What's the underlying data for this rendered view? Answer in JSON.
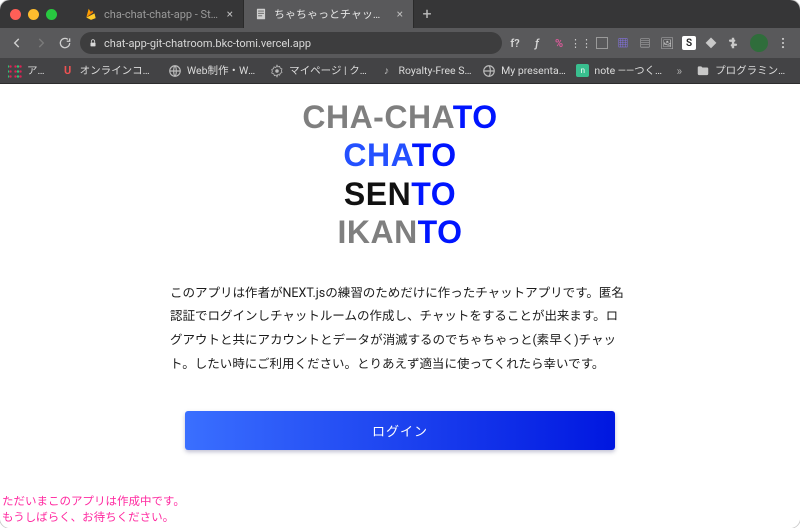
{
  "window": {
    "tabs": [
      {
        "label": "cha-chat-chat-app - Storage",
        "active": false
      },
      {
        "label": "ちゃちゃっとチャットせんといかん",
        "active": true
      }
    ]
  },
  "toolbar": {
    "url": "chat-app-git-chatroom.bkc-tomi.vercel.app"
  },
  "ext_icons": {
    "items": [
      "f?",
      "ƒ",
      "%",
      "⋮⋮",
      "▯",
      "▦",
      "▤",
      "🖼",
      "S",
      "◆"
    ]
  },
  "bookmarks": {
    "items": [
      {
        "label": "アプリ",
        "icon": "apps"
      },
      {
        "label": "オンラインコース -…",
        "icon": "udemy"
      },
      {
        "label": "Web制作・Webデ…",
        "icon": "globe"
      },
      {
        "label": "マイページ | クラウ…",
        "icon": "gear"
      },
      {
        "label": "Royalty-Free Soun…",
        "icon": "note"
      },
      {
        "label": "My presentations",
        "icon": "globe"
      },
      {
        "label": "note ――つくる、…",
        "icon": "note-green"
      },
      {
        "label": "プログラミング関係",
        "icon": "folder"
      }
    ]
  },
  "hero": {
    "lines": [
      {
        "pre": "CHA-CHA",
        "to": "TO",
        "pre_color": "gray"
      },
      {
        "pre": "CHA",
        "to": "TO",
        "pre_color": "blue"
      },
      {
        "pre": "SEN",
        "to": "TO",
        "pre_color": "black"
      },
      {
        "pre": "IKAN",
        "to": "TO",
        "pre_color": "gray"
      }
    ]
  },
  "description": "このアプリは作者がNEXT.jsの練習のためだけに作ったチャットアプリです。匿名認証でログインしチャットルームの作成し、チャットをすることが出来ます。ログアウトと共にアカウントとデータが消滅するのでちゃちゃっと(素早く)チャット。したい時にご利用ください。とりあえず適当に使ってくれたら幸いです。",
  "login_button": "ログイン",
  "notice": {
    "line1": "ただいまこのアプリは作成中です。",
    "line2": "もうしばらく、お待ちください。"
  }
}
